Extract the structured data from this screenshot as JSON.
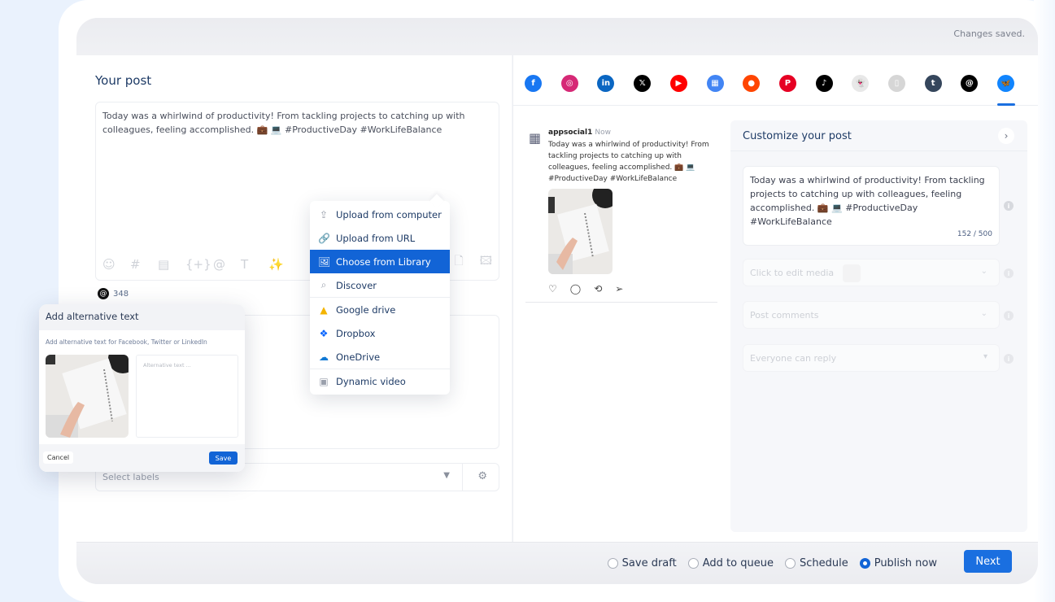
{
  "header": {
    "status": "Changes saved."
  },
  "editor": {
    "title": "Your post",
    "text": "Today was a whirlwind of productivity! From tackling projects to catching up with colleagues, feeling accomplished. 💼 💻 #ProductiveDay #WorkLifeBalance",
    "toolbar_icons": [
      "emoji-icon",
      "hashtag-icon",
      "snippet-icon",
      "variable-icon",
      "mention-icon",
      "text-format-icon",
      "magic-wand-icon"
    ],
    "toolbar_glyphs": [
      "☺",
      "#",
      "▤",
      "{+}",
      "@",
      "T",
      "✨"
    ],
    "thread_count": "348",
    "labels_placeholder": "Select labels"
  },
  "media_menu": {
    "items": [
      {
        "label": "Upload from computer",
        "icon": "upload-icon",
        "glyph": "⇪",
        "color": "#9aa0ac"
      },
      {
        "label": "Upload from URL",
        "icon": "link-icon",
        "glyph": "🔗",
        "color": "#9aa0ac"
      },
      {
        "label": "Choose from Library",
        "icon": "library-icon",
        "glyph": "🖼",
        "color": "#ffffff",
        "highlighted": true
      },
      {
        "label": "Discover",
        "icon": "search-icon",
        "glyph": "⌕",
        "color": "#9aa0ac"
      },
      {
        "label": "Google drive",
        "icon": "google-drive-icon",
        "glyph": "▲",
        "color": "#f4b400"
      },
      {
        "label": "Dropbox",
        "icon": "dropbox-icon",
        "glyph": "❖",
        "color": "#0061fe"
      },
      {
        "label": "OneDrive",
        "icon": "onedrive-icon",
        "glyph": "☁",
        "color": "#0f78d4"
      },
      {
        "label": "Dynamic video",
        "icon": "dynamic-video-icon",
        "glyph": "▣",
        "color": "#9aa0ac"
      }
    ]
  },
  "alt_modal": {
    "title": "Add alternative text",
    "subtitle": "Add alternative text for Facebook, Twitter or LinkedIn",
    "placeholder": "Alternative text ...",
    "cancel": "Cancel",
    "save": "Save"
  },
  "networks": [
    {
      "name": "facebook",
      "color": "#1877f2",
      "glyph": "f"
    },
    {
      "name": "instagram",
      "color": "#d62976",
      "glyph": "◎"
    },
    {
      "name": "linkedin",
      "color": "#0a66c2",
      "glyph": "in"
    },
    {
      "name": "x",
      "color": "#000000",
      "glyph": "𝕏"
    },
    {
      "name": "youtube",
      "color": "#ff0000",
      "glyph": "▶"
    },
    {
      "name": "google-business",
      "color": "#4285f4",
      "glyph": "▦"
    },
    {
      "name": "reddit",
      "color": "#ff4500",
      "glyph": "●"
    },
    {
      "name": "pinterest",
      "color": "#e60023",
      "glyph": "P"
    },
    {
      "name": "tiktok",
      "color": "#000000",
      "glyph": "♪"
    },
    {
      "name": "snapchat",
      "color": "#e8e8e8",
      "glyph": "👻"
    },
    {
      "name": "google-business-2",
      "color": "#d6d6d6",
      "glyph": "▯"
    },
    {
      "name": "tumblr",
      "color": "#35465c",
      "glyph": "t"
    },
    {
      "name": "threads",
      "color": "#000000",
      "glyph": "@"
    },
    {
      "name": "bluesky",
      "color": "#1185fe",
      "glyph": "🦋",
      "active": true
    }
  ],
  "preview": {
    "username": "appsocial1",
    "time": "Now",
    "text": "Today was a whirlwind of productivity! From tackling projects to catching up with colleagues, feeling accomplished. 💼 💻 #ProductiveDay #WorkLifeBalance"
  },
  "customize": {
    "title": "Customize your post",
    "text": "Today was a whirlwind of productivity! From tackling projects to catching up with colleagues, feeling accomplished. 💼 💻 #ProductiveDay #WorkLifeBalance",
    "char_count": "152 / 500",
    "media_label": "Click to edit media",
    "comments_label": "Post comments",
    "reply_label": "Everyone can reply"
  },
  "footer": {
    "options": [
      {
        "label": "Save draft",
        "selected": false
      },
      {
        "label": "Add to queue",
        "selected": false
      },
      {
        "label": "Schedule",
        "selected": false
      },
      {
        "label": "Publish now",
        "selected": true
      }
    ],
    "next": "Next"
  }
}
